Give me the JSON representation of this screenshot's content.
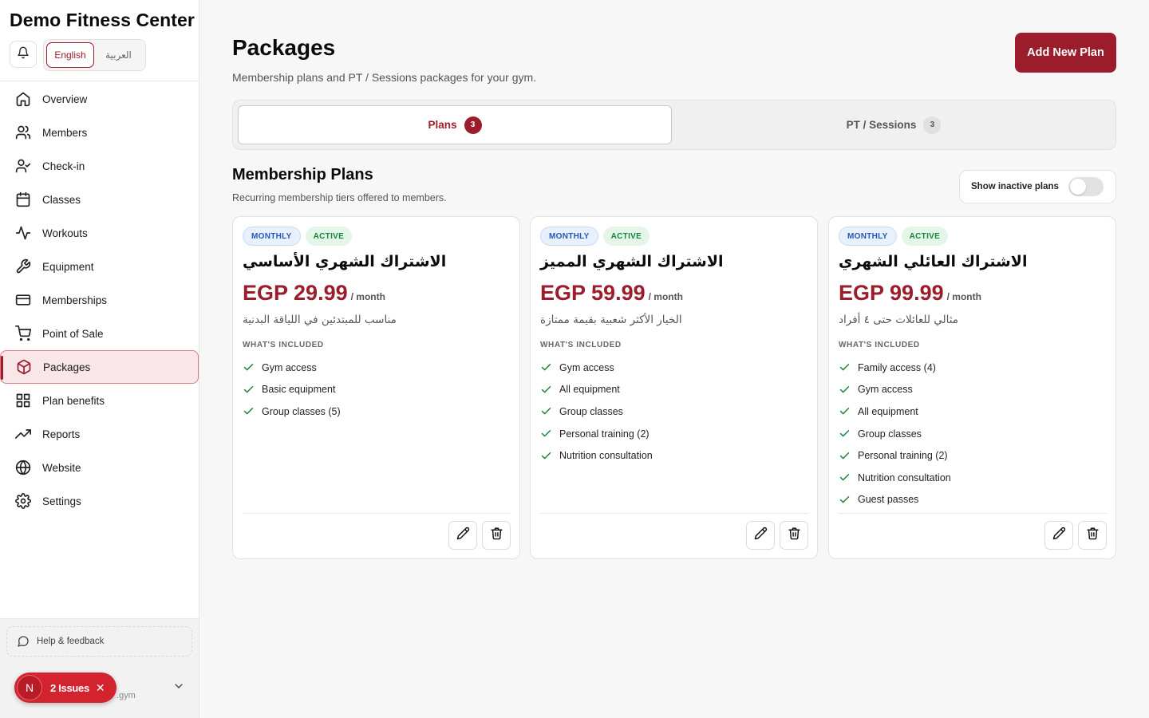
{
  "app": {
    "brand": "Demo Fitness Center",
    "lang_en": "English",
    "lang_ar": "العربية"
  },
  "sidebar": {
    "items": [
      {
        "label": "Overview",
        "icon": "home-icon"
      },
      {
        "label": "Members",
        "icon": "users-icon"
      },
      {
        "label": "Check-in",
        "icon": "user-check-icon"
      },
      {
        "label": "Classes",
        "icon": "calendar-icon"
      },
      {
        "label": "Workouts",
        "icon": "activity-icon"
      },
      {
        "label": "Equipment",
        "icon": "wrench-icon"
      },
      {
        "label": "Memberships",
        "icon": "credit-card-icon"
      },
      {
        "label": "Point of Sale",
        "icon": "cart-icon"
      },
      {
        "label": "Packages",
        "icon": "package-icon",
        "active": true
      },
      {
        "label": "Plan benefits",
        "icon": "grid-icon"
      },
      {
        "label": "Reports",
        "icon": "trending-up-icon"
      },
      {
        "label": "Website",
        "icon": "globe-icon"
      },
      {
        "label": "Settings",
        "icon": "gear-icon"
      }
    ],
    "help": "Help & feedback",
    "user_sub": ".gym",
    "issues_avatar": "N",
    "issues_label": "2 Issues",
    "issues_close": "✕"
  },
  "header": {
    "title": "Packages",
    "subtitle": "Membership plans and PT / Sessions packages for your gym.",
    "add_button": "Add New Plan"
  },
  "tabs": [
    {
      "label": "Plans",
      "count": "3",
      "active": true
    },
    {
      "label": "PT / Sessions",
      "count": "3",
      "active": false
    }
  ],
  "section": {
    "title": "Membership Plans",
    "subtitle": "Recurring membership tiers offered to members.",
    "toggle_label": "Show inactive plans",
    "toggle_on": false
  },
  "plans": [
    {
      "billing": "MONTHLY",
      "status": "ACTIVE",
      "name": "الاشتراك الشهري الأساسي",
      "price": "EGP 29.99",
      "period": "/ month",
      "description": "مناسب للمبتدئين في اللياقة البدنية",
      "included_label": "WHAT'S INCLUDED",
      "features": [
        "Gym access",
        "Basic equipment",
        "Group classes (5)"
      ]
    },
    {
      "billing": "MONTHLY",
      "status": "ACTIVE",
      "name": "الاشتراك الشهري المميز",
      "price": "EGP 59.99",
      "period": "/ month",
      "description": "الخيار الأكثر شعبية بقيمة ممتازة",
      "included_label": "WHAT'S INCLUDED",
      "features": [
        "Gym access",
        "All equipment",
        "Group classes",
        "Personal training (2)",
        "Nutrition consultation"
      ]
    },
    {
      "billing": "MONTHLY",
      "status": "ACTIVE",
      "name": "الاشتراك العائلي الشهري",
      "price": "EGP 99.99",
      "period": "/ month",
      "description": "مثالي للعائلات حتى ٤ أفراد",
      "included_label": "WHAT'S INCLUDED",
      "features": [
        "Family access (4)",
        "Gym access",
        "All equipment",
        "Group classes",
        "Personal training (2)",
        "Nutrition consultation",
        "Guest passes"
      ]
    }
  ],
  "colors": {
    "brand": "#9b1c2a",
    "active_badge": "#16843a",
    "billing_badge": "#2457b8"
  }
}
